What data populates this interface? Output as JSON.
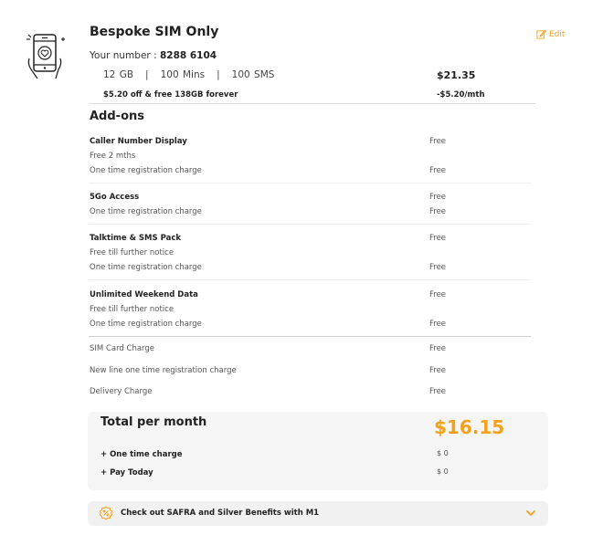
{
  "plan": {
    "title": "Bespoke SIM Only",
    "edit_label": "Edit",
    "number_label": "Your number : ",
    "number_value": "8288 6104",
    "specs": "12 GB   |   100 Mins   |   100 SMS",
    "price": "$21.35",
    "promo": "$5.20 off & free 138GB forever",
    "discount": "-$5.20/mth"
  },
  "addons": {
    "title": "Add-ons",
    "items": [
      {
        "name": "Caller Number Display",
        "value": "Free",
        "sub": "Free 2 mths",
        "reg_label": "One time registration charge",
        "reg_value": "Free"
      },
      {
        "name": "5Go Access",
        "value": "Free",
        "reg_label": "One time registration charge",
        "reg_value": "Free"
      },
      {
        "name": "Talktime & SMS Pack",
        "value": "Free",
        "sub": "Free till further notice",
        "reg_label": "One time registration charge",
        "reg_value": "Free"
      },
      {
        "name": "Unlimited Weekend Data",
        "value": "Free",
        "sub": "Free till further notice",
        "reg_label": "One time registration charge",
        "reg_value": "Free"
      }
    ]
  },
  "charges": [
    {
      "label": "SIM Card Charge",
      "value": "Free"
    },
    {
      "label": "New line one time registration charge",
      "value": "Free"
    },
    {
      "label": "Delivery Charge",
      "value": "Free"
    }
  ],
  "totals": {
    "per_month_label": "Total per month",
    "per_month_value": "$16.15",
    "one_time_label": "+ One time charge",
    "one_time_value": "$ 0",
    "pay_today_label": "+ Pay Today",
    "pay_today_value": "$ 0"
  },
  "benefits": {
    "label": "Check out SAFRA and Silver Benefits with M1"
  },
  "colors": {
    "accent": "#f4a21b"
  }
}
